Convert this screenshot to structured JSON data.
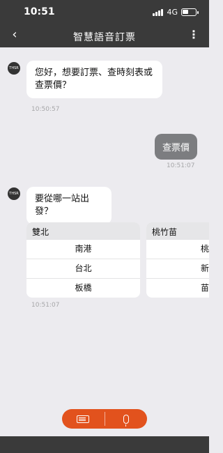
{
  "status": {
    "time": "10:51",
    "network": "4G",
    "battery_level": 0.45
  },
  "nav": {
    "back_icon": "chevron-left-icon",
    "title": "智慧語音訂票",
    "more_icon": "more-vertical-icon"
  },
  "avatar": {
    "label": "THSR"
  },
  "messages": {
    "bot1": {
      "text": "您好，想要訂票、查時刻表或查票價？",
      "time": "10:50:57"
    },
    "user1": {
      "text": "查票價",
      "time": "10:51:07"
    },
    "bot2": {
      "text": "要從哪一站出發？",
      "time": "10:51:07"
    }
  },
  "station_groups": [
    {
      "region": "雙北",
      "stations": [
        "南港",
        "台北",
        "板橋"
      ]
    },
    {
      "region": "桃竹苗",
      "stations": [
        "桃",
        "新",
        "苗"
      ]
    }
  ],
  "station_groups_time": "10:51:07",
  "input": {
    "keyboard_icon": "keyboard-icon",
    "mic_icon": "microphone-icon",
    "accent": "#e2521d"
  }
}
